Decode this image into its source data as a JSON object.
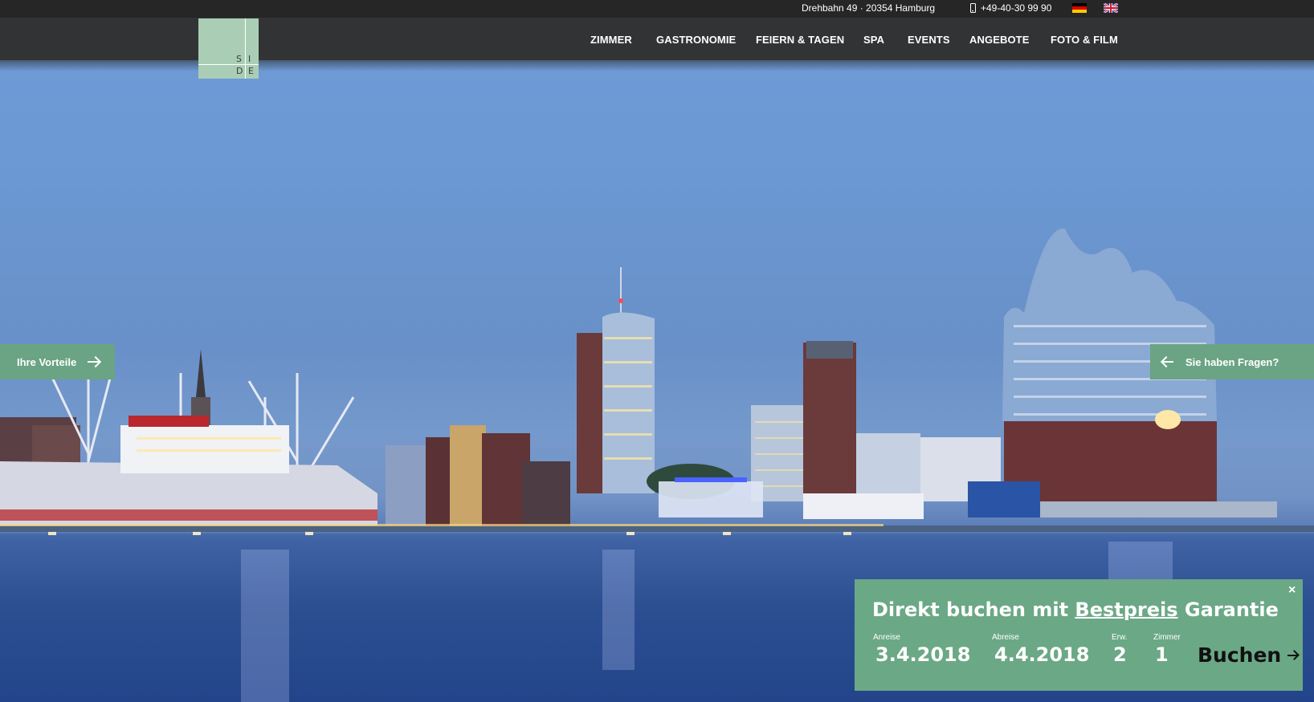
{
  "topbar": {
    "address": "Drehbahn 49 · 20354 Hamburg",
    "phone": "+49-40-30 99 90",
    "languages": [
      "de-flag-icon",
      "en-flag-icon"
    ]
  },
  "logo": {
    "letters": [
      "S",
      "I",
      "D",
      "E"
    ]
  },
  "nav": {
    "items": [
      {
        "label": "ZIMMER"
      },
      {
        "label": "GASTRONOMIE"
      },
      {
        "label": "FEIERN & TAGEN"
      },
      {
        "label": "SPA"
      },
      {
        "label": "EVENTS"
      },
      {
        "label": "ANGEBOTE"
      },
      {
        "label": "FOTO & FILM"
      }
    ]
  },
  "tabs": {
    "left": "Ihre Vorteile",
    "right": "Sie haben Fragen?"
  },
  "booking": {
    "close": "×",
    "headline_pre": "Direkt buchen mit ",
    "headline_link": "Bestpreis",
    "headline_post": " Garantie",
    "arrival_label": "Anreise",
    "arrival_value": "3.4.2018",
    "departure_label": "Abreise",
    "departure_value": "4.4.2018",
    "adults_label": "Erw.",
    "adults_value": "2",
    "rooms_label": "Zimmer",
    "rooms_value": "1",
    "submit": "Buchen"
  },
  "colors": {
    "accent_green": "#6aa484",
    "logo_green": "#a9ceb5",
    "nav_dark": "#343537",
    "topbar_dark": "#262626"
  }
}
